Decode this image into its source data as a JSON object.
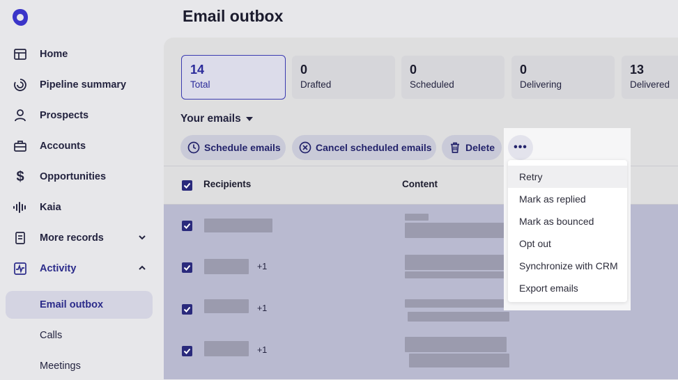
{
  "sidebar": {
    "items": [
      {
        "label": "Home",
        "icon": "home-icon"
      },
      {
        "label": "Pipeline summary",
        "icon": "pipeline-icon"
      },
      {
        "label": "Prospects",
        "icon": "person-icon"
      },
      {
        "label": "Accounts",
        "icon": "briefcase-icon"
      },
      {
        "label": "Opportunities",
        "icon": "dollar-icon"
      },
      {
        "label": "Kaia",
        "icon": "waveform-icon"
      },
      {
        "label": "More records",
        "icon": "records-icon"
      },
      {
        "label": "Activity",
        "icon": "activity-icon"
      }
    ],
    "subitems": [
      {
        "label": "Email outbox"
      },
      {
        "label": "Calls"
      },
      {
        "label": "Meetings"
      }
    ]
  },
  "page": {
    "title": "Email outbox"
  },
  "stats": [
    {
      "value": "14",
      "label": "Total"
    },
    {
      "value": "0",
      "label": "Drafted"
    },
    {
      "value": "0",
      "label": "Scheduled"
    },
    {
      "value": "0",
      "label": "Delivering"
    },
    {
      "value": "13",
      "label": "Delivered"
    }
  ],
  "filter": {
    "label": "Your emails"
  },
  "toolbar": {
    "schedule": "Schedule emails",
    "cancel": "Cancel scheduled emails",
    "delete": "Delete"
  },
  "table": {
    "headers": {
      "recipients": "Recipients",
      "content": "Content"
    },
    "rows": [
      {
        "extra": ""
      },
      {
        "extra": "+1"
      },
      {
        "extra": "+1"
      },
      {
        "extra": "+1"
      }
    ]
  },
  "menu": {
    "items": [
      "Retry",
      "Mark as replied",
      "Mark as bounced",
      "Opt out",
      "Synchronize with CRM",
      "Export emails"
    ]
  },
  "colors": {
    "accent": "#2b2b8a",
    "selected_bg": "#d4d4e2"
  }
}
